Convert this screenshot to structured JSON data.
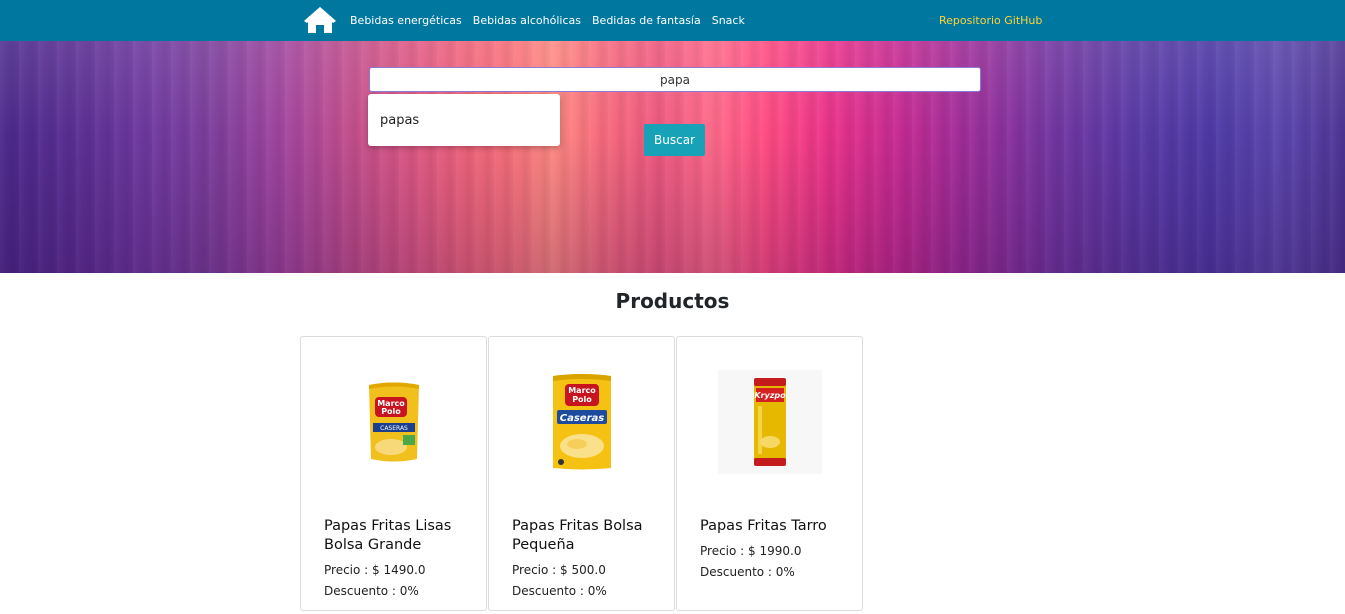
{
  "nav": {
    "home_icon": "home-icon",
    "links": [
      "Bebidas energéticas",
      "Bebidas alcohólicas",
      "Bedidas de fantasía",
      "Snack"
    ],
    "github_label": "Repositorio GitHub",
    "bg_color": "#00779e",
    "github_color": "#ffd43b"
  },
  "search": {
    "value": "papa",
    "suggestion": "papas",
    "button_label": "Buscar",
    "button_color": "#17a2b8"
  },
  "products": {
    "title": "Productos",
    "items": [
      {
        "name": "Papas Fritas Lisas Bolsa Grande",
        "price_label": "Precio : $ 1490.0",
        "discount_label": "Descuento : 0%",
        "image_icon": "marco-polo-chips-bag-icon"
      },
      {
        "name": "Papas Fritas Bolsa Pequeña",
        "price_label": "Precio : $ 500.0",
        "discount_label": "Descuento : 0%",
        "image_icon": "marco-polo-caseras-bag-icon"
      },
      {
        "name": "Papas Fritas Tarro",
        "price_label": "Precio : $ 1990.0",
        "discount_label": "Descuento : 0%",
        "image_icon": "kryzpo-can-icon"
      }
    ]
  }
}
